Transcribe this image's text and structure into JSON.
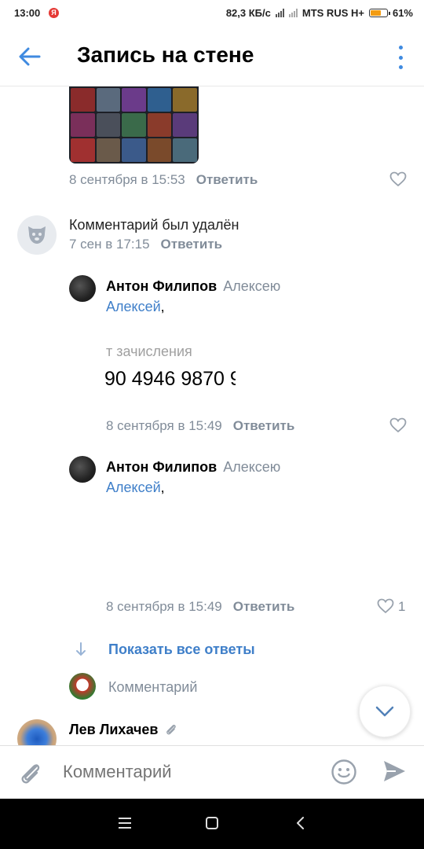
{
  "status_bar": {
    "time": "13:00",
    "notification_badge": "Я",
    "speed": "82,3 КБ/с",
    "carrier": "MTS RUS H+",
    "battery": "61%",
    "battery_level": 0.61
  },
  "header": {
    "title": "Запись на стене"
  },
  "thread": {
    "top_comment": {
      "date": "8 сентября в 15:53",
      "reply_label": "Ответить"
    },
    "deleted_comment": {
      "text": "Комментарий был удалён",
      "date": "7 сен в 17:15",
      "reply_label": "Ответить"
    },
    "replies": [
      {
        "author": "Антон Филипов",
        "to": "Алексею",
        "mention": "Алексей",
        "punct": ",",
        "image_text_label": "т зачисления",
        "image_text_number": "90 4946 9870 9",
        "date": "8 сентября в 15:49",
        "reply_label": "Ответить",
        "likes": ""
      },
      {
        "author": "Антон Филипов",
        "to": "Алексею",
        "mention": "Алексей",
        "punct": ",",
        "date": "8 сентября в 15:49",
        "reply_label": "Ответить",
        "likes": "1"
      }
    ],
    "show_all_label": "Показать все ответы",
    "comment_placeholder": "Комментарий",
    "next_comment_author": "Лев Лихачев"
  },
  "input_bar": {
    "placeholder": "Комментарий"
  },
  "colors": {
    "accent": "#3f8ae0",
    "link": "#3f7fc9",
    "secondary_text": "#818c99"
  },
  "icons": [
    "back-arrow-icon",
    "more-vertical-icon",
    "heart-icon",
    "deleted-user-icon",
    "arrow-down-icon",
    "chevron-down-icon",
    "paperclip-icon",
    "smile-icon",
    "send-icon",
    "nav-menu-icon",
    "nav-home-icon",
    "nav-back-icon"
  ]
}
